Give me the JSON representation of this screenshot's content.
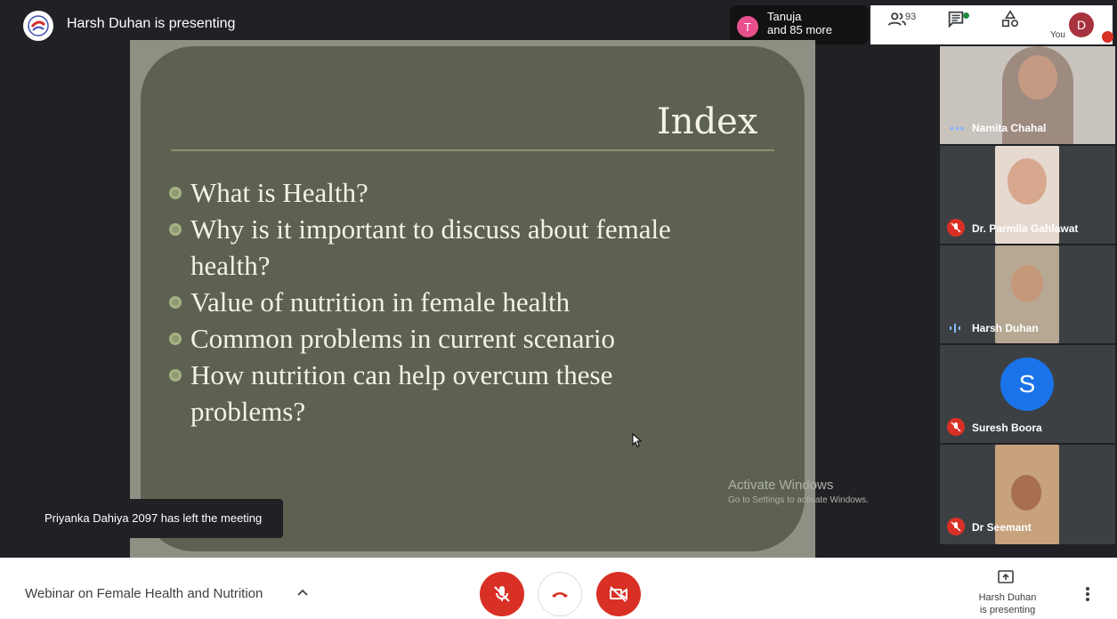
{
  "topbar": {
    "presenting_title": "Harsh Duhan is presenting",
    "spotlight_initial": "T",
    "spotlight_line1": "Tanuja",
    "spotlight_line2": "and 85 more",
    "people_count": "93",
    "you_label": "You",
    "you_initial": "D"
  },
  "slide": {
    "title": "Index",
    "bullets": [
      "What is Health?",
      "Why is it important to discuss about female health?",
      "Value of nutrition in female health",
      "Common problems in current scenario",
      "How nutrition can help overcum these problems?"
    ],
    "watermark_line1": "Activate Windows",
    "watermark_line2": "Go to Settings to activate Windows."
  },
  "toast": "Priyanka Dahiya 2097 has left the meeting",
  "participants": [
    {
      "name": "Namita Chahal",
      "status": "dots"
    },
    {
      "name": "Dr. Parmila Gahlawat",
      "status": "muted"
    },
    {
      "name": "Harsh Duhan",
      "status": "speaking"
    },
    {
      "name": "Suresh Boora",
      "status": "muted",
      "initial": "S"
    },
    {
      "name": "Dr Seemant",
      "status": "muted"
    }
  ],
  "bottombar": {
    "meeting_title": "Webinar on Female Health and Nutrition",
    "presenter_line1": "Harsh Duhan",
    "presenter_line2": "is presenting"
  },
  "colors": {
    "red": "#d93025",
    "dark": "#202124",
    "slide_bg": "#5c6151",
    "slide_border": "#8d9184",
    "avatar_blue": "#1a73e8",
    "tanuja_pink": "#e8508c",
    "you_avatar": "#a8323e"
  },
  "icons": [
    "logo-icon",
    "people-icon",
    "chat-icon",
    "activities-icon",
    "mic-off-icon",
    "end-call-icon",
    "camera-off-icon",
    "present-screen-icon",
    "more-vert-icon",
    "chevron-up-icon"
  ]
}
